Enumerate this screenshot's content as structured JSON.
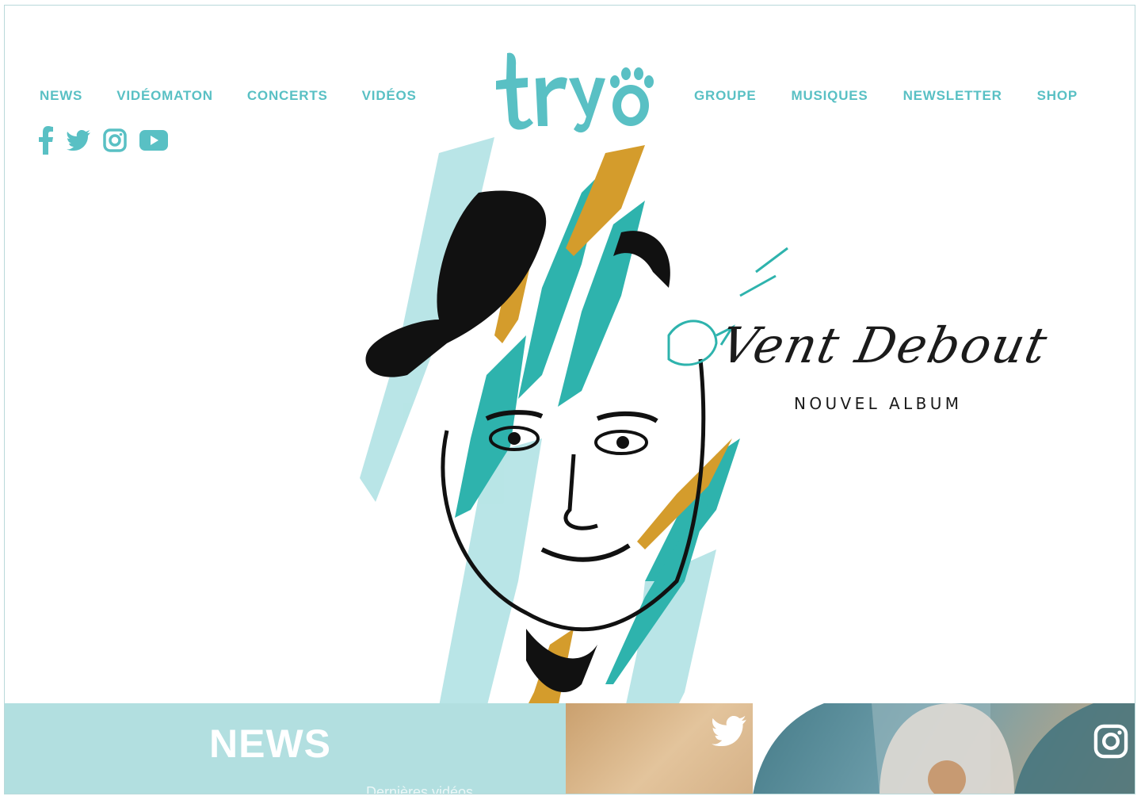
{
  "nav": {
    "left": [
      "NEWS",
      "VIDÉOMATON",
      "CONCERTS",
      "VIDÉOS"
    ],
    "right": [
      "GROUPE",
      "MUSIQUES",
      "NEWSLETTER",
      "SHOP"
    ]
  },
  "brand": {
    "logo_text": "tryo"
  },
  "social": [
    "facebook-icon",
    "twitter-icon",
    "instagram-icon",
    "youtube-icon"
  ],
  "hero": {
    "album_title": "Vent Debout",
    "album_subtitle": "NOUVEL ALBUM"
  },
  "bottom": {
    "news_title": "NEWS",
    "news_hint": "Dernières vidéos"
  },
  "colors": {
    "accent": "#59c0c4",
    "news_band": "#b2dfe0",
    "twitter_band": "#d9b88d",
    "insta_band": "#4f8491",
    "text_dark": "#1b1b1b"
  }
}
